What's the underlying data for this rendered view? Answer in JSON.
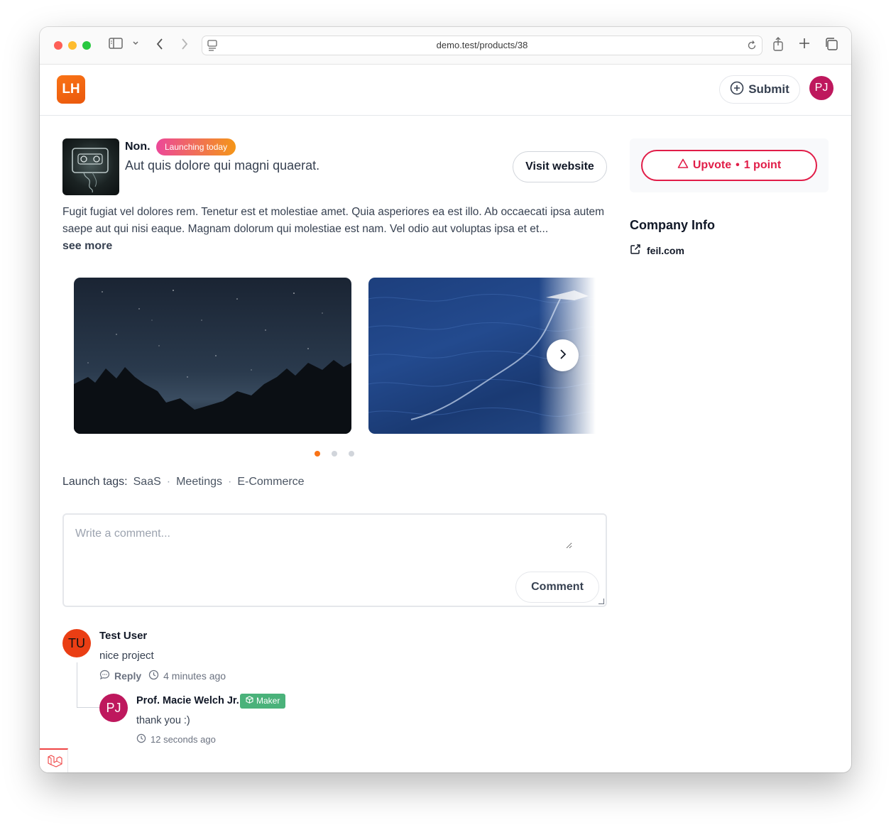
{
  "browser": {
    "url": "demo.test/products/38",
    "icons": [
      "sidebar-icon",
      "chevron-down-icon",
      "back-icon",
      "forward-icon",
      "site-icon",
      "reload-icon",
      "share-icon",
      "new-tab-icon",
      "tabs-icon"
    ]
  },
  "header": {
    "logo_text": "LH",
    "submit_label": "Submit",
    "avatar_initials": "PJ"
  },
  "product": {
    "name": "Non.",
    "badge": "Launching today",
    "tagline": "Aut quis dolore qui magni quaerat.",
    "visit_label": "Visit website",
    "description": "Fugit fugiat vel dolores rem. Tenetur est et molestiae amet. Quia asperiores ea est illo. Ab occaecati ipsa autem saepe aut qui nisi eaque. Magnam dolorum qui molestiae est nam. Vel odio aut voluptas ipsa et et...",
    "see_more_label": "see more"
  },
  "gallery": {
    "active_index": 0,
    "slide_count": 3
  },
  "tags": {
    "label": "Launch tags:",
    "items": [
      "SaaS",
      "Meetings",
      "E-Commerce"
    ],
    "separator": "·"
  },
  "comment_form": {
    "placeholder": "Write a comment...",
    "submit_label": "Comment"
  },
  "comments": [
    {
      "initials": "TU",
      "author": "Test User",
      "text": "nice project",
      "reply_label": "Reply",
      "time": "4 minutes ago",
      "replies": [
        {
          "initials": "PJ",
          "author": "Prof. Macie Welch Jr.",
          "badge": "Maker",
          "text": "thank you :)",
          "time": "12 seconds ago"
        }
      ]
    }
  ],
  "sidebar": {
    "upvote_label": "Upvote",
    "upvote_separator": "•",
    "upvote_points": "1 point",
    "company_title": "Company Info",
    "company_link": "feil.com"
  },
  "colors": {
    "accent": "#f97316",
    "upvote": "#e11d48",
    "maker": "#4ab27a",
    "avatar_pj": "#be185d",
    "avatar_tu": "#ea3e14"
  }
}
